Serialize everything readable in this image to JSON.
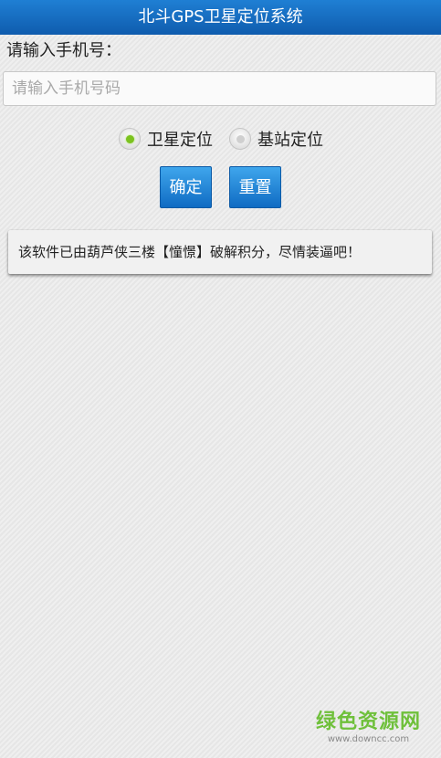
{
  "app": {
    "title": "北斗GPS卫星定位系统"
  },
  "form": {
    "phone_label": "请输入手机号：",
    "phone_placeholder": "请输入手机号码",
    "phone_value": ""
  },
  "radios": {
    "satellite_label": "卫星定位",
    "satellite_selected": true,
    "base_station_label": "基站定位",
    "base_station_selected": false
  },
  "buttons": {
    "confirm_label": "确定",
    "reset_label": "重置"
  },
  "notice": {
    "text": "该软件已由葫芦侠三楼【憧憬】破解积分，尽情装逼吧！"
  },
  "watermark": {
    "main": "绿色资源网",
    "sub": "www.downcc.com"
  },
  "colors": {
    "title_bar": "#1565b9",
    "button": "#1d7dd6",
    "radio_on": "#7cc21f",
    "watermark": "#6fc03b"
  }
}
